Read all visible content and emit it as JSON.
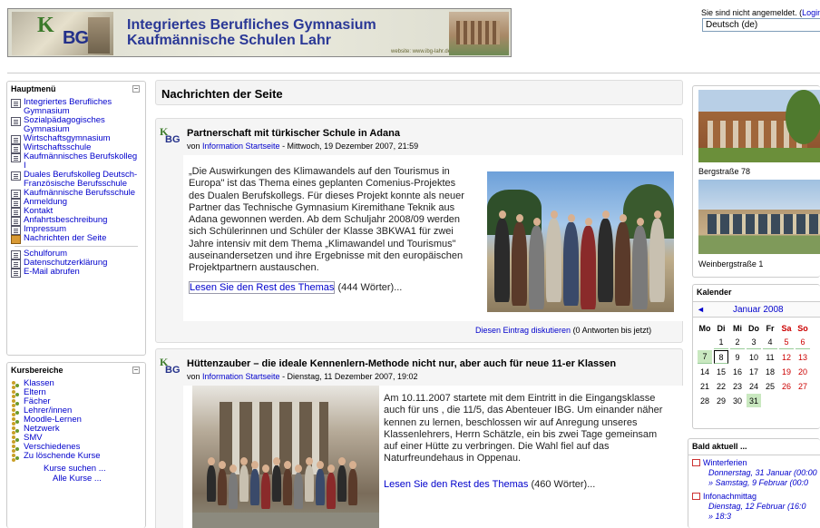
{
  "header": {
    "title_line1": "Integriertes Berufliches Gymnasium",
    "title_line2": "Kaufmännische Schulen Lahr",
    "website": "website: www.ibg-lahr.de",
    "logo_k": "K",
    "logo_bg": "BG"
  },
  "login": {
    "text": "Sie sind nicht angemeldet. (",
    "link": "Login",
    "close": ")"
  },
  "language": {
    "selected": "Deutsch (de)"
  },
  "main_menu": {
    "title": "Hauptmenü",
    "items": [
      {
        "label": "Integriertes Berufliches Gymnasium",
        "icon": "document-icon"
      },
      {
        "label": "Sozialpädagogisches Gymnasium",
        "icon": "document-icon"
      },
      {
        "label": "Wirtschaftsgymnasium",
        "icon": "document-icon"
      },
      {
        "label": "Wirtschaftsschule",
        "icon": "document-icon"
      },
      {
        "label": "Kaufmännisches Berufskolleg I",
        "icon": "document-icon"
      },
      {
        "label": "Duales Berufskolleg Deutsch-Französische Berufsschule",
        "icon": "document-icon"
      },
      {
        "label": "Kaufmännische Berufsschule",
        "icon": "document-icon"
      },
      {
        "label": "Anmeldung",
        "icon": "document-icon"
      },
      {
        "label": "Kontakt",
        "icon": "document-icon"
      },
      {
        "label": "Anfahrtsbeschreibung",
        "icon": "document-icon"
      },
      {
        "label": "Impressum",
        "icon": "document-icon"
      },
      {
        "label": "Nachrichten der Seite",
        "icon": "news-icon"
      },
      {
        "label": "Schulforum",
        "icon": "document-icon"
      },
      {
        "label": "Datenschutzerklärung",
        "icon": "document-icon"
      },
      {
        "label": "E-Mail abrufen",
        "icon": "document-icon"
      }
    ]
  },
  "courses": {
    "title": "Kursbereiche",
    "items": [
      "Klassen",
      "Eltern",
      "Fächer",
      "Lehrer/innen",
      "Moodle-Lernen",
      "Netzwerk",
      "SMV",
      "Verschiedenes",
      "Zu löschende Kurse"
    ],
    "search": "Kurse suchen ...",
    "all": "Alle Kurse ..."
  },
  "center": {
    "heading": "Nachrichten der Seite",
    "posts": [
      {
        "title": "Partnerschaft mit türkischer Schule in Adana",
        "by_prefix": "von ",
        "author": "Information Startseite",
        "date": " - Mittwoch, 19 Dezember 2007, 21:59",
        "lines": [
          "„Die Auswirkungen des Klimawandels auf den Tourismus in",
          "Europa\" ist das Thema eines geplanten Comenius-Projektes",
          "des Dualen Berufskollegs. Für dieses Projekt konnte als neuer",
          "Partner das Technische Gymnasium Kiremithane Teknik aus",
          "Adana gewonnen werden. Ab dem Schuljahr 2008/09 werden",
          "sich Schülerinnen und Schüler der Klasse 3BKWA1 für zwei",
          "Jahre intensiv mit dem Thema „Klimawandel und Tourismus\"",
          "auseinandersetzen und ihre Ergebnisse mit den europäischen",
          "Projektpartnern austauschen."
        ],
        "read_more": "Lesen Sie den Rest des Themas",
        "words": " (444 Wörter)...",
        "discuss": "Diesen Eintrag diskutieren",
        "answers": " (0 Antworten bis jetzt)"
      },
      {
        "title": "Hüttenzauber – die ideale Kennenlern-Methode nicht nur, aber auch für neue 11-er Klassen",
        "by_prefix": "von ",
        "author": "Information Startseite",
        "date": " - Dienstag, 11 Dezember 2007, 19:02",
        "lines": [
          "Am 10.11.2007 startete mit dem Eintritt in die Eingangsklasse",
          "auch für uns , die 11/5, das Abenteuer IBG. Um einander näher",
          "kennen zu lernen, beschlossen wir auf Anregung unseres",
          "Klassenlehrers, Herrn Schätzle, ein bis zwei Tage gemeinsam",
          "auf einer Hütte zu verbringen. Die Wahl fiel auf das",
          "Naturfreundehaus in Oppenau."
        ],
        "read_more": "Lesen Sie den Rest des Themas",
        "words": " (460 Wörter)..."
      }
    ]
  },
  "right": {
    "photo1_caption": "Bergstraße 78",
    "photo2_caption": "Weinbergstraße 1",
    "calendar": {
      "title": "Kalender",
      "month": "Januar 2008",
      "prev": "◄",
      "days": [
        "Mo",
        "Di",
        "Mi",
        "Do",
        "Fr",
        "Sa",
        "So"
      ],
      "weeks": [
        [
          "",
          "1",
          "2",
          "3",
          "4",
          "5",
          "6"
        ],
        [
          "7",
          "8",
          "9",
          "10",
          "11",
          "12",
          "13"
        ],
        [
          "14",
          "15",
          "16",
          "17",
          "18",
          "19",
          "20"
        ],
        [
          "21",
          "22",
          "23",
          "24",
          "25",
          "26",
          "27"
        ],
        [
          "28",
          "29",
          "30",
          "31",
          "",
          "",
          ""
        ]
      ]
    },
    "upcoming": {
      "title": "Bald aktuell ...",
      "events": [
        {
          "name": "Winterferien",
          "d1": "Donnerstag, 31 Januar (00:00",
          "d2": "» Samstag, 9 Februar (00:0"
        },
        {
          "name": "Infonachmittag",
          "d1": "Dienstag, 12 Februar (16:0",
          "d2": "» 18:3"
        }
      ]
    }
  },
  "colors": {
    "link": "#0000cc",
    "weekend": "#cc0000",
    "event_day": "#c9e8c0",
    "banner_title": "#2a3896"
  }
}
